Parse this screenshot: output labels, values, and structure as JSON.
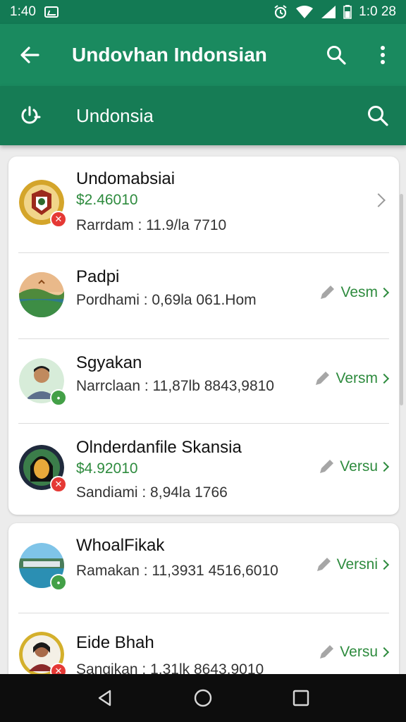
{
  "status_bar": {
    "time": "1:40",
    "battery_text": "1:0 28"
  },
  "app_bar": {
    "title": "Undovhan Indonsian"
  },
  "search": {
    "query": "Undonsia"
  },
  "items": [
    {
      "name": "Undomabsiai",
      "price": "$2.46010",
      "sub": "Rarrdam : 11.9/la 7710",
      "badge": "red",
      "action": ""
    },
    {
      "name": "Padpi",
      "price": "",
      "sub": "Pordhami : 0,69la 061.Hom",
      "badge": "",
      "action": "Vesm"
    },
    {
      "name": "Sgyakan",
      "price": "",
      "sub": "Narrclaan : 11,87lb 8843,9810",
      "badge": "green",
      "action": "Versm"
    },
    {
      "name": "Olnderdanfile Skansia",
      "price": "$4.92010",
      "sub": "Sandiami : 8,94la 1766",
      "badge": "red",
      "action": "Versu"
    },
    {
      "name": "WhoalFikak",
      "price": "",
      "sub": "Ramakan : 11,3931 4516,6010",
      "badge": "green",
      "action": "Versni"
    },
    {
      "name": "Eide Bhah",
      "price": "",
      "sub": "Sangikan : 1,31lk 8643,9010",
      "badge": "red",
      "action": "Versu"
    }
  ],
  "colors": {
    "primary": "#1a8a5f",
    "primary_dark": "#137a54",
    "accent_green": "#2e8b3e",
    "badge_red": "#e53935",
    "badge_green": "#43a047"
  }
}
